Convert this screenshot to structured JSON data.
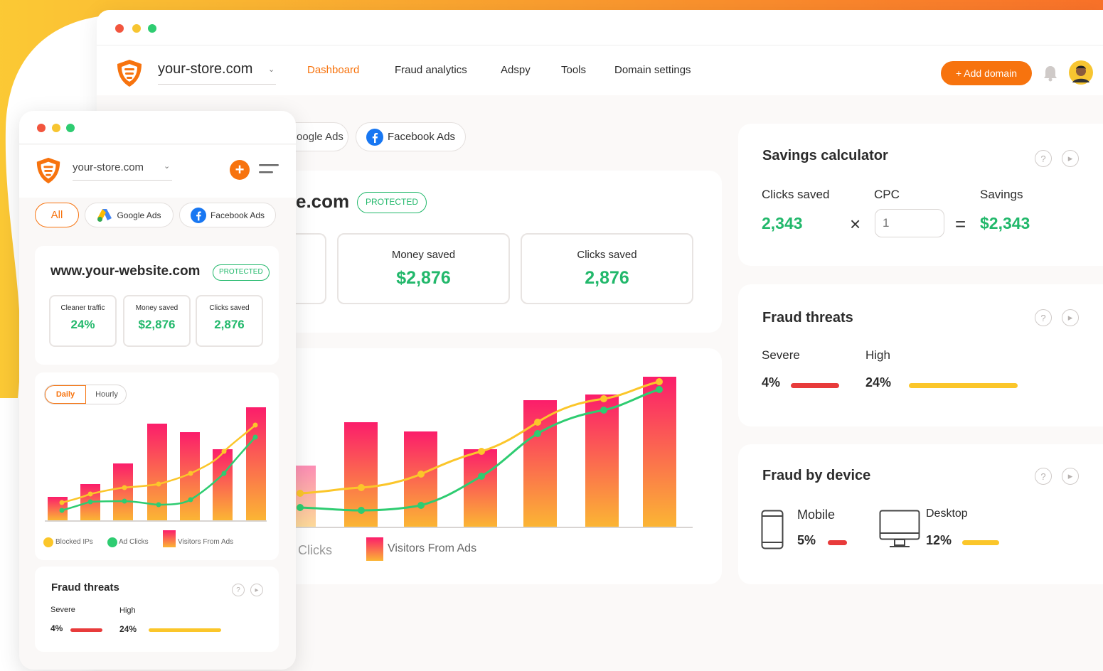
{
  "desktop": {
    "domain": "your-store.com",
    "nav": [
      "Dashboard",
      "Fraud analytics",
      "Adspy",
      "Tools",
      "Domain settings"
    ],
    "add_domain": "+ Add domain",
    "filters": [
      "oogle Ads",
      "Facebook Ads"
    ],
    "site_title_fragment": "e.com",
    "protected": "PROTECTED",
    "stats": [
      {
        "label": "Money saved",
        "value": "$2,876"
      },
      {
        "label": "Clicks saved",
        "value": "2,876"
      }
    ],
    "legend": [
      "l Clicks",
      "Visitors From Ads"
    ],
    "savings": {
      "title": "Savings calculator",
      "clicks_label": "Clicks saved",
      "clicks_value": "2,343",
      "cpc_label": "CPC",
      "cpc_placeholder": "1",
      "savings_label": "Savings",
      "savings_value": "$2,343",
      "times": "×",
      "equals": "="
    },
    "fraud_threats": {
      "title": "Fraud threats",
      "severe_label": "Severe",
      "severe_value": "4%",
      "high_label": "High",
      "high_value": "24%"
    },
    "fraud_device": {
      "title": "Fraud by device",
      "mobile_label": "Mobile",
      "mobile_value": "5%",
      "desktop_label": "Desktop",
      "desktop_value": "12%"
    }
  },
  "mobile": {
    "domain": "your-store.com",
    "filters": [
      "All",
      "Google Ads",
      "Facebook Ads"
    ],
    "site": "www.your-website.com",
    "protected": "PROTECTED",
    "stats": [
      {
        "label": "Cleaner traffic",
        "value": "24%"
      },
      {
        "label": "Money saved",
        "value": "$2,876"
      },
      {
        "label": "Clicks saved",
        "value": "2,876"
      }
    ],
    "tabs": [
      "Daily",
      "Hourly"
    ],
    "legend": [
      "Blocked IPs",
      "Ad Clicks",
      "Visitors From Ads"
    ],
    "fraud_threats": {
      "title": "Fraud threats",
      "severe_label": "Severe",
      "severe_value": "4%",
      "high_label": "High",
      "high_value": "24%"
    }
  },
  "colors": {
    "accent": "#f7730e",
    "green": "#22b86b",
    "red": "#e83b3b",
    "yellow": "#fbc62a",
    "bar_top": "#fb1d6b",
    "bar_bottom": "#fbb534"
  }
}
